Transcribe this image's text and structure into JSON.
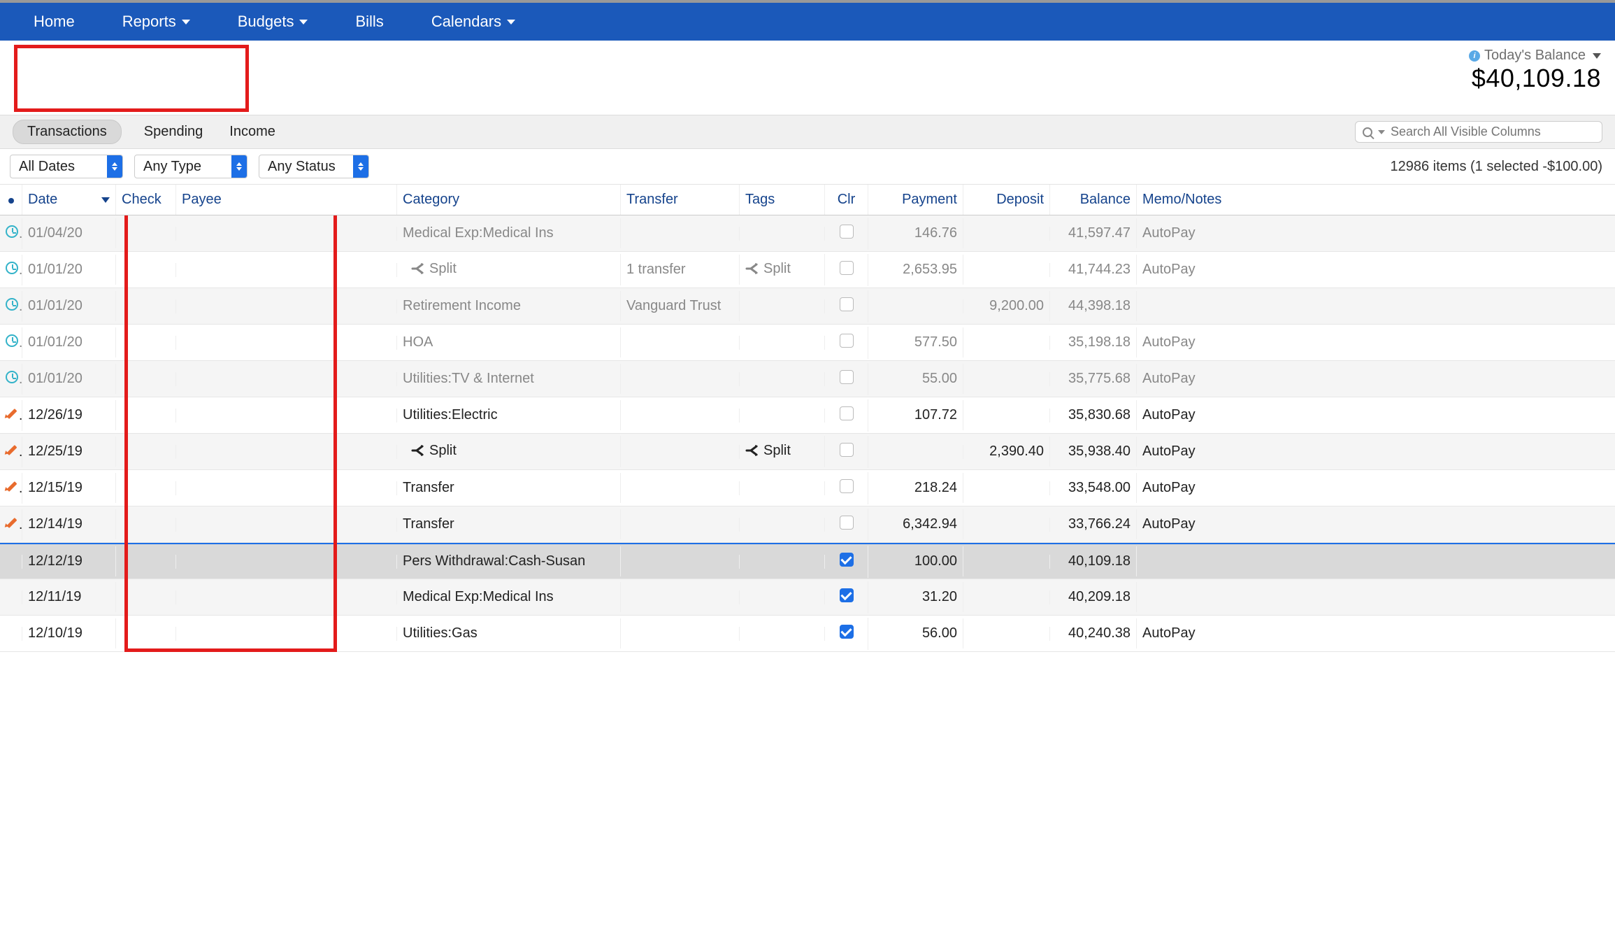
{
  "nav": {
    "home": "Home",
    "reports": "Reports",
    "budgets": "Budgets",
    "bills": "Bills",
    "calendars": "Calendars"
  },
  "balance": {
    "label": "Today's Balance",
    "amount": "$40,109.18"
  },
  "tabs": {
    "transactions": "Transactions",
    "spending": "Spending",
    "income": "Income"
  },
  "search": {
    "placeholder": "Search All Visible Columns"
  },
  "filters": {
    "dates": "All Dates",
    "type": "Any Type",
    "status": "Any Status",
    "count": "12986 items (1 selected -$100.00)"
  },
  "columns": {
    "date": "Date",
    "check": "Check",
    "payee": "Payee",
    "category": "Category",
    "transfer": "Transfer",
    "tags": "Tags",
    "clr": "Clr",
    "payment": "Payment",
    "deposit": "Deposit",
    "balance": "Balance",
    "memo": "Memo/Notes"
  },
  "rows": [
    {
      "status": "scheduled",
      "date": "01/04/20",
      "payee": "",
      "category": "Medical Exp:Medical Ins",
      "transfer": "",
      "tags": "",
      "clr": false,
      "payment": "146.76",
      "deposit": "",
      "balance": "41,597.47",
      "memo": "AutoPay",
      "split_cat": false,
      "split_tag": false
    },
    {
      "status": "scheduled",
      "date": "01/01/20",
      "payee": "",
      "category": "Split",
      "transfer": "1 transfer",
      "tags": "Split",
      "clr": false,
      "payment": "2,653.95",
      "deposit": "",
      "balance": "41,744.23",
      "memo": "AutoPay",
      "split_cat": true,
      "split_tag": true
    },
    {
      "status": "scheduled",
      "date": "01/01/20",
      "payee": "",
      "category": "Retirement Income",
      "transfer": "Vanguard Trust",
      "tags": "",
      "clr": false,
      "payment": "",
      "deposit": "9,200.00",
      "balance": "44,398.18",
      "memo": "",
      "split_cat": false,
      "split_tag": false
    },
    {
      "status": "scheduled",
      "date": "01/01/20",
      "payee": "",
      "category": "HOA",
      "transfer": "",
      "tags": "",
      "clr": false,
      "payment": "577.50",
      "deposit": "",
      "balance": "35,198.18",
      "memo": "AutoPay",
      "split_cat": false,
      "split_tag": false
    },
    {
      "status": "scheduled",
      "date": "01/01/20",
      "payee": "",
      "category": "Utilities:TV & Internet",
      "transfer": "",
      "tags": "",
      "clr": false,
      "payment": "55.00",
      "deposit": "",
      "balance": "35,775.68",
      "memo": "AutoPay",
      "split_cat": false,
      "split_tag": false
    },
    {
      "status": "pending",
      "date": "12/26/19",
      "payee": "",
      "category": "Utilities:Electric",
      "transfer": "",
      "tags": "",
      "clr": false,
      "payment": "107.72",
      "deposit": "",
      "balance": "35,830.68",
      "memo": "AutoPay",
      "split_cat": false,
      "split_tag": false
    },
    {
      "status": "pending",
      "date": "12/25/19",
      "payee": "",
      "category": "Split",
      "transfer": "",
      "tags": "Split",
      "clr": false,
      "payment": "",
      "deposit": "2,390.40",
      "balance": "35,938.40",
      "memo": "AutoPay",
      "split_cat": true,
      "split_tag": true
    },
    {
      "status": "pending",
      "date": "12/15/19",
      "payee": "",
      "category": "Transfer",
      "transfer": "",
      "tags": "",
      "clr": false,
      "payment": "218.24",
      "deposit": "",
      "balance": "33,548.00",
      "memo": "AutoPay",
      "split_cat": false,
      "split_tag": false
    },
    {
      "status": "pending",
      "date": "12/14/19",
      "payee": "",
      "category": "Transfer",
      "transfer": "",
      "tags": "",
      "clr": false,
      "payment": "6,342.94",
      "deposit": "",
      "balance": "33,766.24",
      "memo": "AutoPay",
      "split_cat": false,
      "split_tag": false
    },
    {
      "status": "cleared",
      "date": "12/12/19",
      "payee": "",
      "category": "Pers Withdrawal:Cash-Susan",
      "transfer": "",
      "tags": "",
      "clr": true,
      "payment": "100.00",
      "deposit": "",
      "balance": "40,109.18",
      "memo": "",
      "split_cat": false,
      "split_tag": false,
      "selected": true,
      "sep": true
    },
    {
      "status": "cleared",
      "date": "12/11/19",
      "payee": "",
      "category": "Medical Exp:Medical Ins",
      "transfer": "",
      "tags": "",
      "clr": true,
      "payment": "31.20",
      "deposit": "",
      "balance": "40,209.18",
      "memo": "",
      "split_cat": false,
      "split_tag": false
    },
    {
      "status": "cleared",
      "date": "12/10/19",
      "payee": "",
      "category": "Utilities:Gas",
      "transfer": "",
      "tags": "",
      "clr": true,
      "payment": "56.00",
      "deposit": "",
      "balance": "40,240.38",
      "memo": "AutoPay",
      "split_cat": false,
      "split_tag": false
    }
  ]
}
